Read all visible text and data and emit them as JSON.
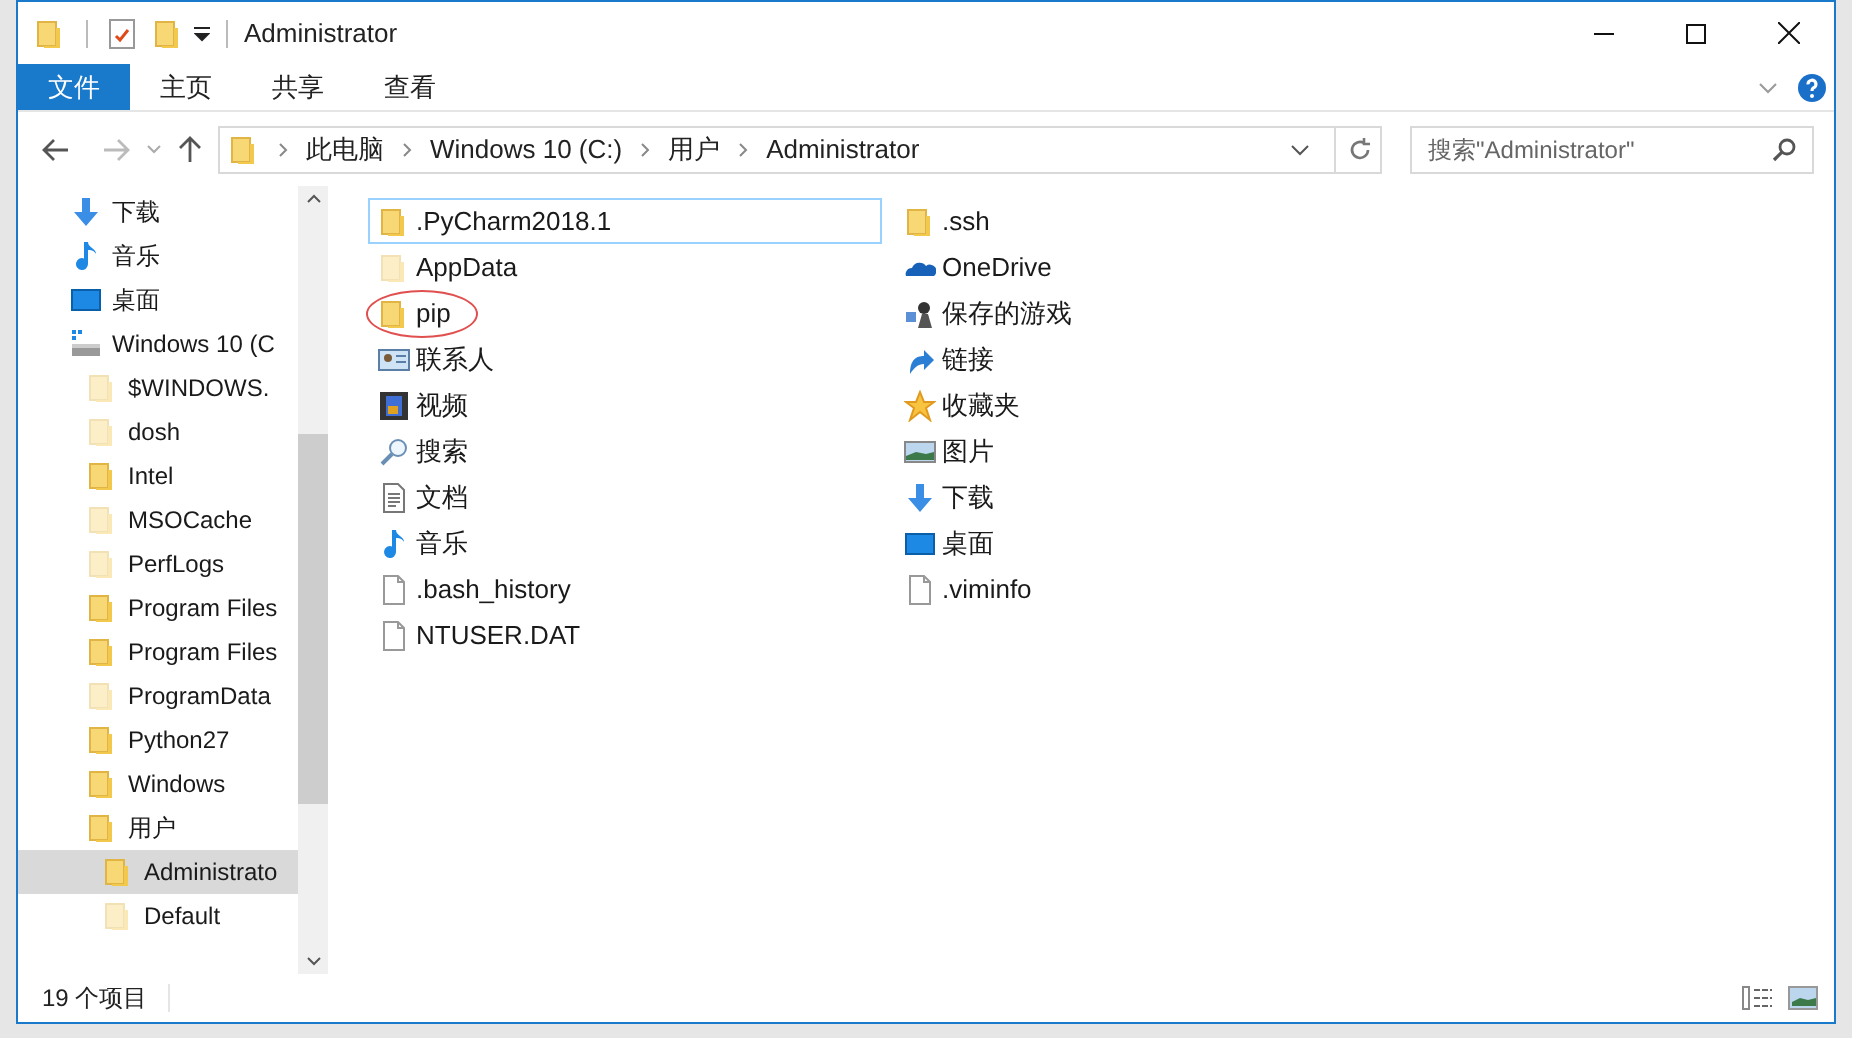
{
  "window": {
    "title": "Administrator"
  },
  "ribbon_tabs": [
    {
      "label": "文件",
      "selected": true
    },
    {
      "label": "主页",
      "selected": false
    },
    {
      "label": "共享",
      "selected": false
    },
    {
      "label": "查看",
      "selected": false
    }
  ],
  "breadcrumb": [
    "此电脑",
    "Windows 10 (C:)",
    "用户",
    "Administrator"
  ],
  "search": {
    "placeholder": "搜索\"Administrator\""
  },
  "sidebar": {
    "items": [
      {
        "label": "下载",
        "kind": "download",
        "selected": false
      },
      {
        "label": "音乐",
        "kind": "music",
        "selected": false
      },
      {
        "label": "桌面",
        "kind": "desktop",
        "selected": false
      },
      {
        "label": "Windows 10 (C",
        "kind": "drive",
        "selected": false,
        "children": [
          {
            "label": "$WINDOWS.",
            "kind": "folder",
            "hidden": true,
            "selected": false
          },
          {
            "label": "dosh",
            "kind": "folder",
            "hidden": true,
            "selected": false
          },
          {
            "label": "Intel",
            "kind": "folder",
            "hidden": false,
            "selected": false
          },
          {
            "label": "MSOCache",
            "kind": "folder",
            "hidden": true,
            "selected": false
          },
          {
            "label": "PerfLogs",
            "kind": "folder",
            "hidden": true,
            "selected": false
          },
          {
            "label": "Program Files",
            "kind": "folder",
            "hidden": false,
            "selected": false
          },
          {
            "label": "Program Files",
            "kind": "folder",
            "hidden": false,
            "selected": false
          },
          {
            "label": "ProgramData",
            "kind": "folder",
            "hidden": true,
            "selected": false
          },
          {
            "label": "Python27",
            "kind": "folder",
            "hidden": false,
            "selected": false
          },
          {
            "label": "Windows",
            "kind": "folder",
            "hidden": false,
            "selected": false
          },
          {
            "label": "用户",
            "kind": "folder",
            "hidden": false,
            "selected": false,
            "children": [
              {
                "label": "Administrato",
                "kind": "folder",
                "hidden": false,
                "selected": true
              },
              {
                "label": "Default",
                "kind": "folder",
                "hidden": true,
                "selected": false
              }
            ]
          }
        ]
      }
    ]
  },
  "files": [
    {
      "name": ".PyCharm2018.1",
      "kind": "folder",
      "hidden": false,
      "selected": true,
      "circled": false
    },
    {
      "name": "AppData",
      "kind": "folder",
      "hidden": true,
      "selected": false,
      "circled": false
    },
    {
      "name": "pip",
      "kind": "folder",
      "hidden": false,
      "selected": false,
      "circled": true
    },
    {
      "name": "联系人",
      "kind": "contacts",
      "selected": false,
      "circled": false
    },
    {
      "name": "视频",
      "kind": "video",
      "selected": false,
      "circled": false
    },
    {
      "name": "搜索",
      "kind": "search",
      "selected": false,
      "circled": false
    },
    {
      "name": "文档",
      "kind": "document",
      "selected": false,
      "circled": false
    },
    {
      "name": "音乐",
      "kind": "music",
      "selected": false,
      "circled": false
    },
    {
      "name": ".bash_history",
      "kind": "file",
      "selected": false,
      "circled": false
    },
    {
      "name": "NTUSER.DAT",
      "kind": "file",
      "selected": false,
      "circled": false
    },
    {
      "name": ".ssh",
      "kind": "folder",
      "hidden": false,
      "selected": false,
      "circled": false
    },
    {
      "name": "OneDrive",
      "kind": "onedrive",
      "selected": false,
      "circled": false
    },
    {
      "name": "保存的游戏",
      "kind": "games",
      "selected": false,
      "circled": false
    },
    {
      "name": "链接",
      "kind": "link",
      "selected": false,
      "circled": false
    },
    {
      "name": "收藏夹",
      "kind": "favorites",
      "selected": false,
      "circled": false
    },
    {
      "name": "图片",
      "kind": "pictures",
      "selected": false,
      "circled": false
    },
    {
      "name": "下载",
      "kind": "download",
      "selected": false,
      "circled": false
    },
    {
      "name": "桌面",
      "kind": "desktop",
      "selected": false,
      "circled": false
    },
    {
      "name": ".viminfo",
      "kind": "file",
      "selected": false,
      "circled": false
    }
  ],
  "status_bar": {
    "count": "19 个项目"
  }
}
